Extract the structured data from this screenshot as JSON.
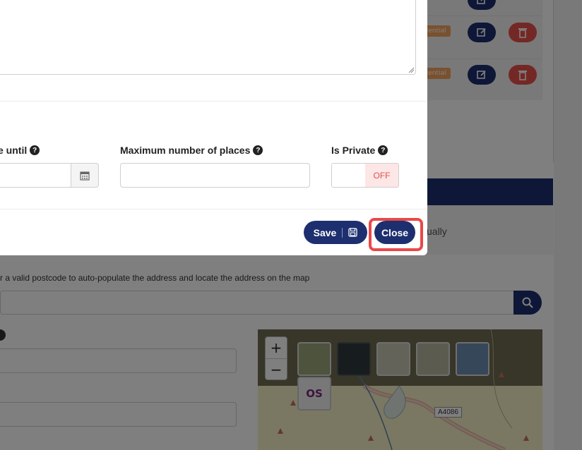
{
  "background": {
    "list_tags": [
      "idential",
      "idential"
    ],
    "manual_text": "ually",
    "postcode_hint": "r a valid postcode to auto-populate the address and locate the address on the map",
    "map": {
      "zoom_in": "+",
      "zoom_out": "−",
      "road_label": "A4086",
      "os_logo_text": "OS"
    }
  },
  "modal": {
    "fields": {
      "available_until_label": "e until",
      "max_places_label": "Maximum number of places",
      "max_places_value": "",
      "is_private_label": "Is Private",
      "is_private_state": "OFF"
    },
    "footer": {
      "save_label": "Save",
      "close_label": "Close"
    }
  },
  "colors": {
    "primary": "#1d2f6f",
    "danger": "#e8504a",
    "highlight": "#e94848",
    "toggle_off_bg": "#fde6e6"
  }
}
